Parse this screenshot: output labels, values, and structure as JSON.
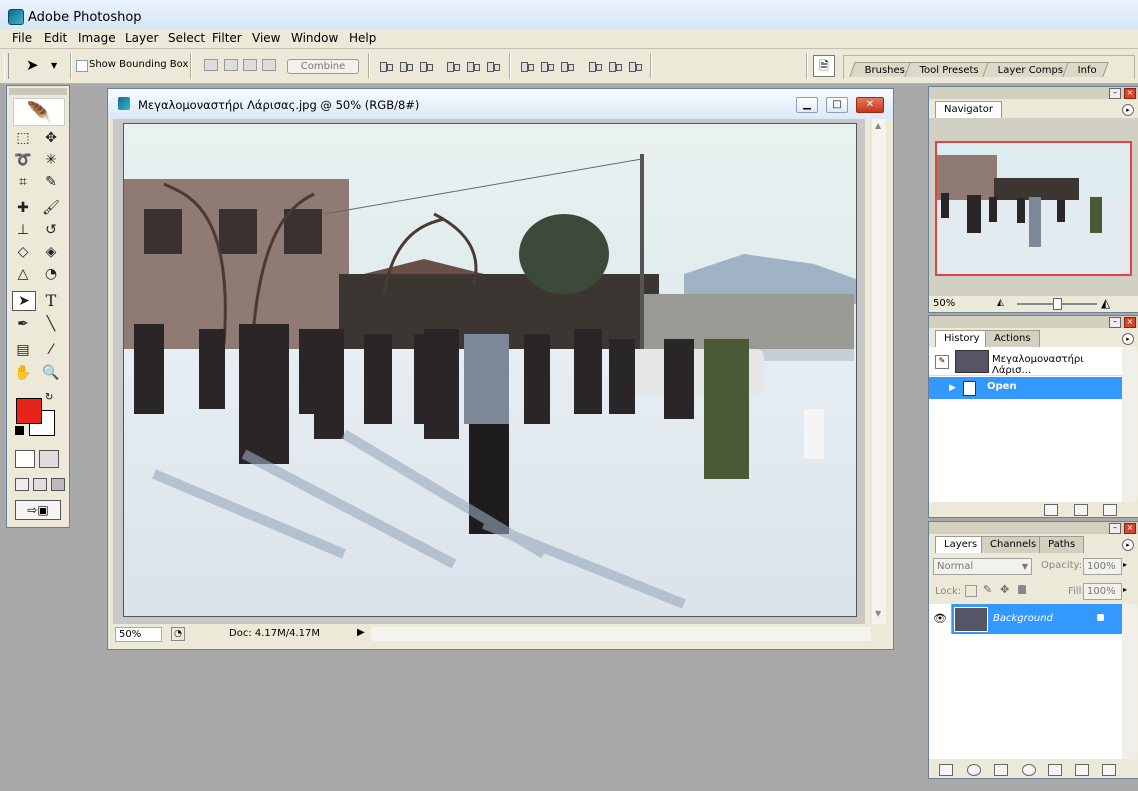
{
  "app": {
    "title": "Adobe Photoshop"
  },
  "menu": [
    "File",
    "Edit",
    "Image",
    "Layer",
    "Select",
    "Filter",
    "View",
    "Window",
    "Help"
  ],
  "options": {
    "show_bounding_box_label": "Show Bounding Box",
    "show_bounding_box_checked": false,
    "combine_label": "Combine"
  },
  "palette_well": {
    "tabs": [
      "Brushes",
      "Tool Presets",
      "Layer Comps",
      "Info"
    ]
  },
  "document": {
    "title": "Μεγαλομοναστήρι Λάρισας.jpg @ 50% (RGB/8#)",
    "zoom": "50%",
    "doc_info": "Doc: 4.17M/4.17M"
  },
  "tools": {
    "foreground_color": "#e8231b",
    "background_color": "#ffffff",
    "text_tool_glyph": "T"
  },
  "navigator": {
    "tab": "Navigator",
    "zoom": "50%",
    "zoom_slider_level": 0.45,
    "view_box_color": "#e0444a"
  },
  "history": {
    "tabs": [
      "History",
      "Actions"
    ],
    "snapshot_label": "Μεγαλομοναστήρι Λάρισ...",
    "states": [
      {
        "label": "Open",
        "selected": true
      }
    ]
  },
  "layers": {
    "tabs": [
      "Layers",
      "Channels",
      "Paths"
    ],
    "blend_mode": "Normal",
    "opacity_label": "Opacity:",
    "opacity": "100%",
    "lock_label": "Lock:",
    "fill_label": "Fill:",
    "fill": "100%",
    "items": [
      {
        "name": "Background",
        "visible": true,
        "locked": true,
        "selected": true
      }
    ]
  },
  "colors": {
    "selection": "#3399ff",
    "photo_sky": "#dfecef",
    "photo_plaza": "#dfe5ea"
  }
}
